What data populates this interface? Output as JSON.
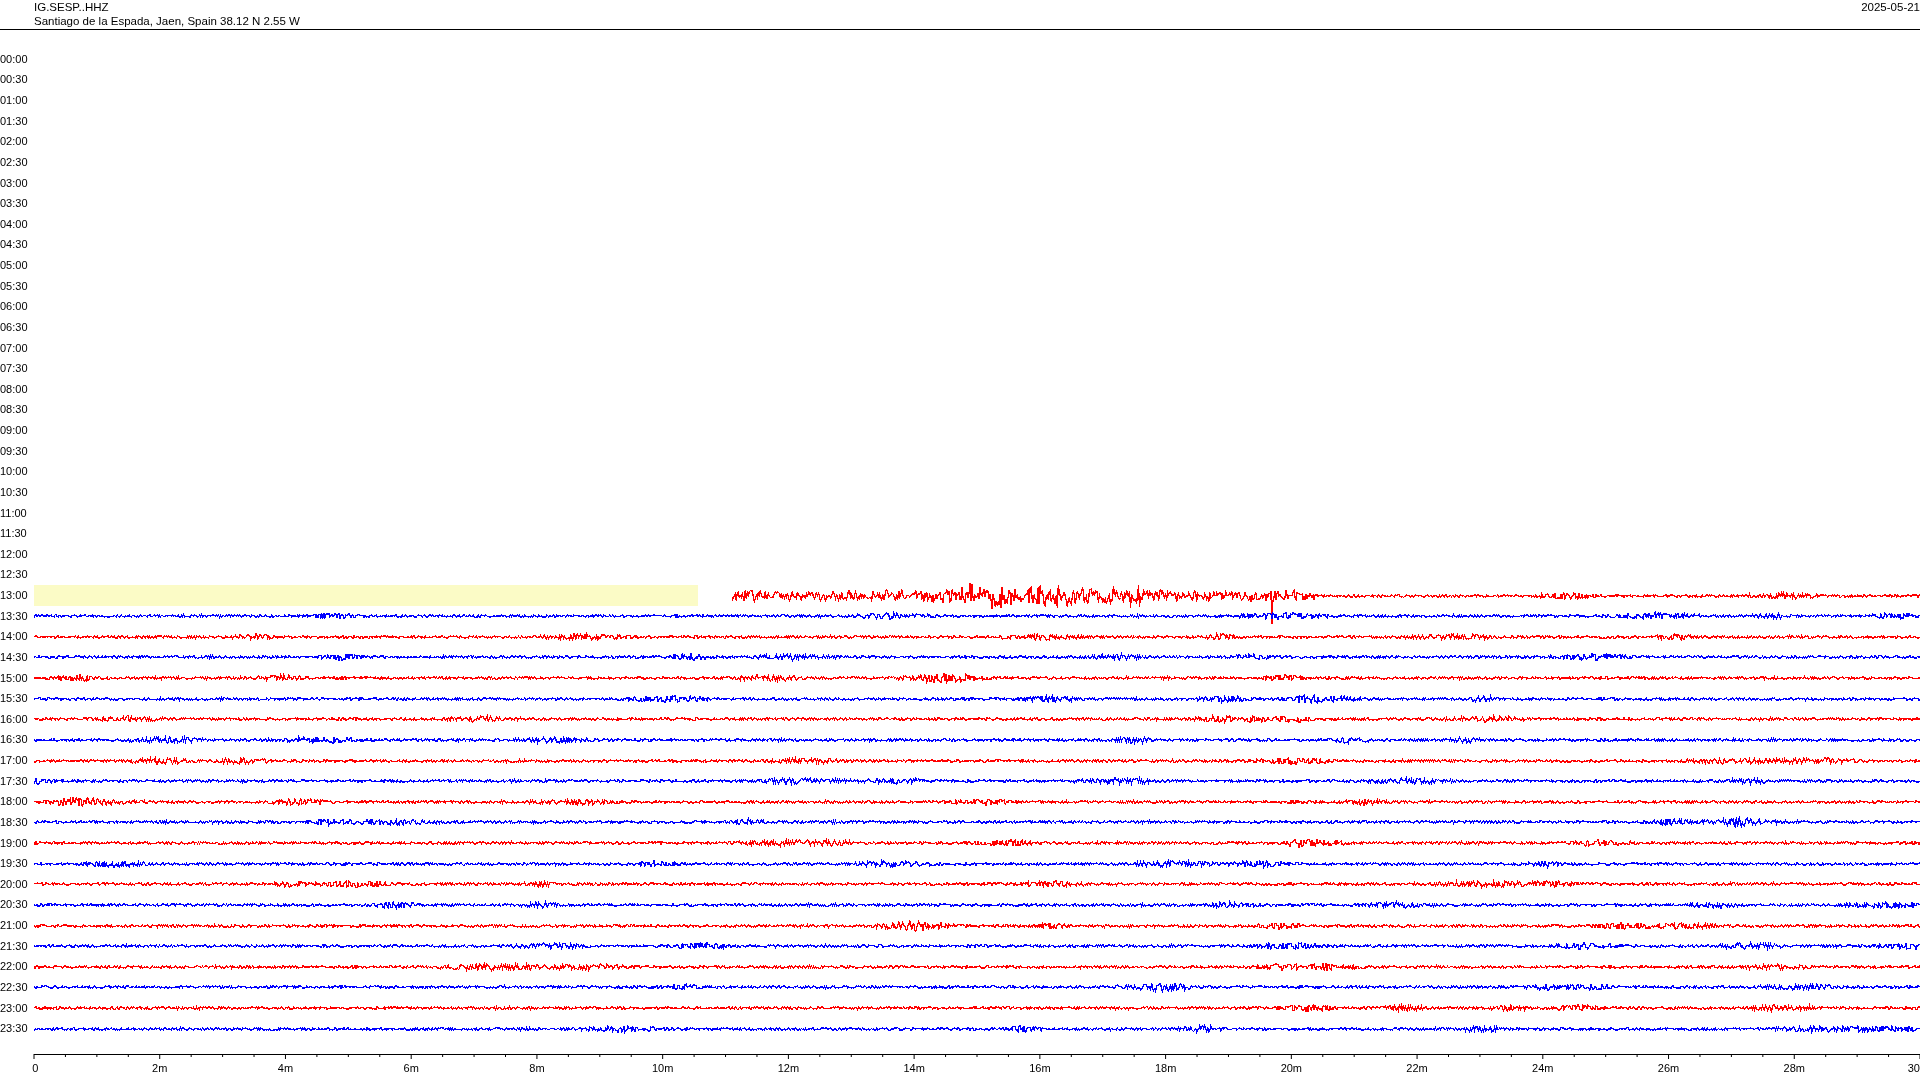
{
  "header": {
    "station": "IG.SESP..HHZ",
    "location": "Santiago de la Espada, Jaen, Spain  38.12 N 2.55 W",
    "date": "2025-05-21"
  },
  "rows": [
    {
      "label": "00:00",
      "kind": "empty"
    },
    {
      "label": "00:30",
      "kind": "empty"
    },
    {
      "label": "01:00",
      "kind": "empty"
    },
    {
      "label": "01:30",
      "kind": "empty"
    },
    {
      "label": "02:00",
      "kind": "empty"
    },
    {
      "label": "02:30",
      "kind": "empty"
    },
    {
      "label": "03:00",
      "kind": "empty"
    },
    {
      "label": "03:30",
      "kind": "empty"
    },
    {
      "label": "04:00",
      "kind": "empty"
    },
    {
      "label": "04:30",
      "kind": "empty"
    },
    {
      "label": "05:00",
      "kind": "empty"
    },
    {
      "label": "05:30",
      "kind": "empty"
    },
    {
      "label": "06:00",
      "kind": "empty"
    },
    {
      "label": "06:30",
      "kind": "empty"
    },
    {
      "label": "07:00",
      "kind": "empty"
    },
    {
      "label": "07:30",
      "kind": "empty"
    },
    {
      "label": "08:00",
      "kind": "empty"
    },
    {
      "label": "08:30",
      "kind": "empty"
    },
    {
      "label": "09:00",
      "kind": "empty"
    },
    {
      "label": "09:30",
      "kind": "empty"
    },
    {
      "label": "10:00",
      "kind": "empty"
    },
    {
      "label": "10:30",
      "kind": "empty"
    },
    {
      "label": "11:00",
      "kind": "empty"
    },
    {
      "label": "11:30",
      "kind": "empty"
    },
    {
      "label": "12:00",
      "kind": "empty"
    },
    {
      "label": "12:30",
      "kind": "empty"
    },
    {
      "label": "13:00",
      "kind": "gap",
      "color": "#ff0000"
    },
    {
      "label": "13:30",
      "kind": "trace",
      "color": "#0000ff"
    },
    {
      "label": "14:00",
      "kind": "trace",
      "color": "#ff0000"
    },
    {
      "label": "14:30",
      "kind": "trace",
      "color": "#0000ff"
    },
    {
      "label": "15:00",
      "kind": "trace",
      "color": "#ff0000"
    },
    {
      "label": "15:30",
      "kind": "trace",
      "color": "#0000ff"
    },
    {
      "label": "16:00",
      "kind": "trace",
      "color": "#ff0000"
    },
    {
      "label": "16:30",
      "kind": "trace",
      "color": "#0000ff"
    },
    {
      "label": "17:00",
      "kind": "trace",
      "color": "#ff0000"
    },
    {
      "label": "17:30",
      "kind": "trace",
      "color": "#0000ff"
    },
    {
      "label": "18:00",
      "kind": "trace",
      "color": "#ff0000"
    },
    {
      "label": "18:30",
      "kind": "trace",
      "color": "#0000ff"
    },
    {
      "label": "19:00",
      "kind": "trace",
      "color": "#ff0000"
    },
    {
      "label": "19:30",
      "kind": "trace",
      "color": "#0000ff"
    },
    {
      "label": "20:00",
      "kind": "trace",
      "color": "#ff0000"
    },
    {
      "label": "20:30",
      "kind": "trace",
      "color": "#0000ff"
    },
    {
      "label": "21:00",
      "kind": "trace",
      "color": "#ff0000"
    },
    {
      "label": "21:30",
      "kind": "trace",
      "color": "#0000ff"
    },
    {
      "label": "22:00",
      "kind": "trace",
      "color": "#ff0000"
    },
    {
      "label": "22:30",
      "kind": "trace",
      "color": "#0000ff"
    },
    {
      "label": "23:00",
      "kind": "trace",
      "color": "#ff0000"
    },
    {
      "label": "23:30",
      "kind": "trace",
      "color": "#0000ff"
    }
  ],
  "axis": {
    "labels": [
      "0",
      "2m",
      "4m",
      "6m",
      "8m",
      "10m",
      "12m",
      "14m",
      "16m",
      "18m",
      "20m",
      "22m",
      "24m",
      "26m",
      "28m",
      "30"
    ]
  }
}
